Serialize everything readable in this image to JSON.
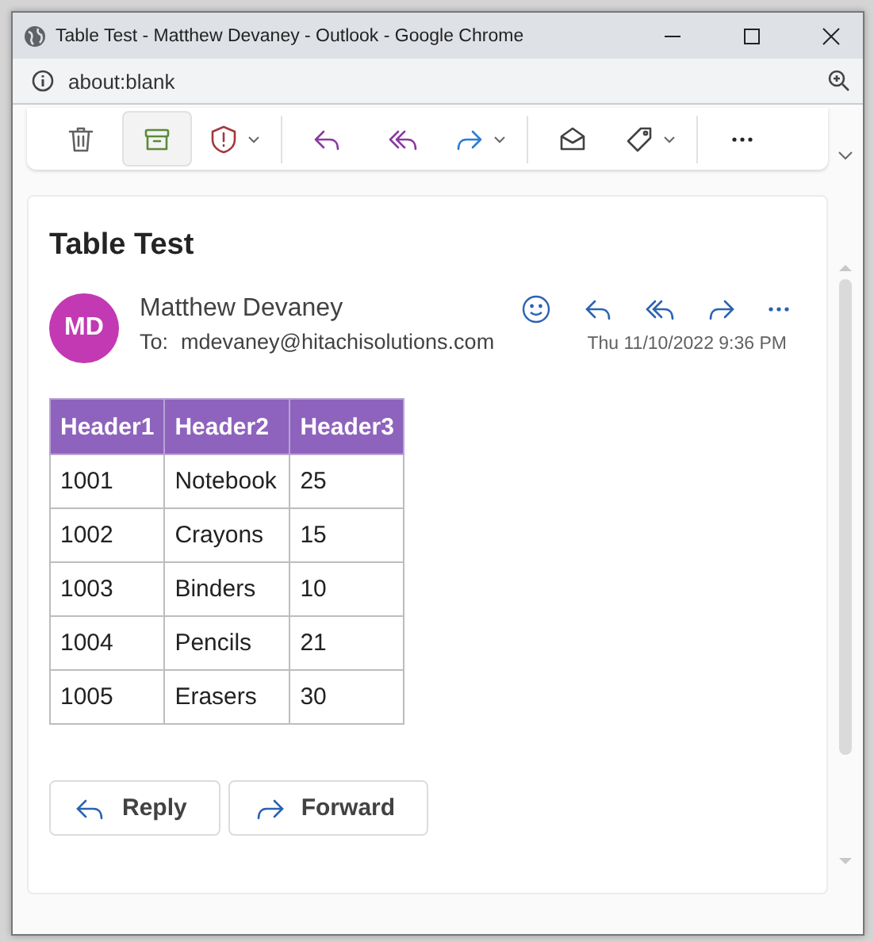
{
  "window": {
    "title": "Table Test - Matthew Devaney - Outlook - Google Chrome"
  },
  "address_bar": {
    "url": "about:blank"
  },
  "toolbar": [
    {
      "kind": "delete",
      "dropdown": false,
      "selected": false
    },
    {
      "kind": "archive",
      "dropdown": false,
      "selected": true
    },
    {
      "kind": "report",
      "dropdown": true,
      "selected": false
    },
    {
      "kind": "sep"
    },
    {
      "kind": "reply",
      "dropdown": false,
      "selected": false
    },
    {
      "kind": "reply-all",
      "dropdown": false,
      "selected": false
    },
    {
      "kind": "forward",
      "dropdown": true,
      "selected": false
    },
    {
      "kind": "sep"
    },
    {
      "kind": "read",
      "dropdown": false,
      "selected": false
    },
    {
      "kind": "tag",
      "dropdown": true,
      "selected": false
    },
    {
      "kind": "sep"
    },
    {
      "kind": "more",
      "dropdown": false,
      "selected": false
    }
  ],
  "message": {
    "subject": "Table Test",
    "initials": "MD",
    "sender": "Matthew Devaney",
    "to_label": "To:",
    "to": "mdevaney@hitachisolutions.com",
    "date": "Thu 11/10/2022 9:36 PM",
    "table": {
      "columns": [
        "Header1",
        "Header2",
        "Header3"
      ],
      "rows": [
        [
          "1001",
          "Notebook",
          "25"
        ],
        [
          "1002",
          "Crayons",
          "15"
        ],
        [
          "1003",
          "Binders",
          "10"
        ],
        [
          "1004",
          "Pencils",
          "21"
        ],
        [
          "1005",
          "Erasers",
          "30"
        ]
      ]
    },
    "buttons": [
      {
        "kind": "reply",
        "label": "Reply"
      },
      {
        "kind": "forward",
        "label": "Forward"
      }
    ]
  }
}
